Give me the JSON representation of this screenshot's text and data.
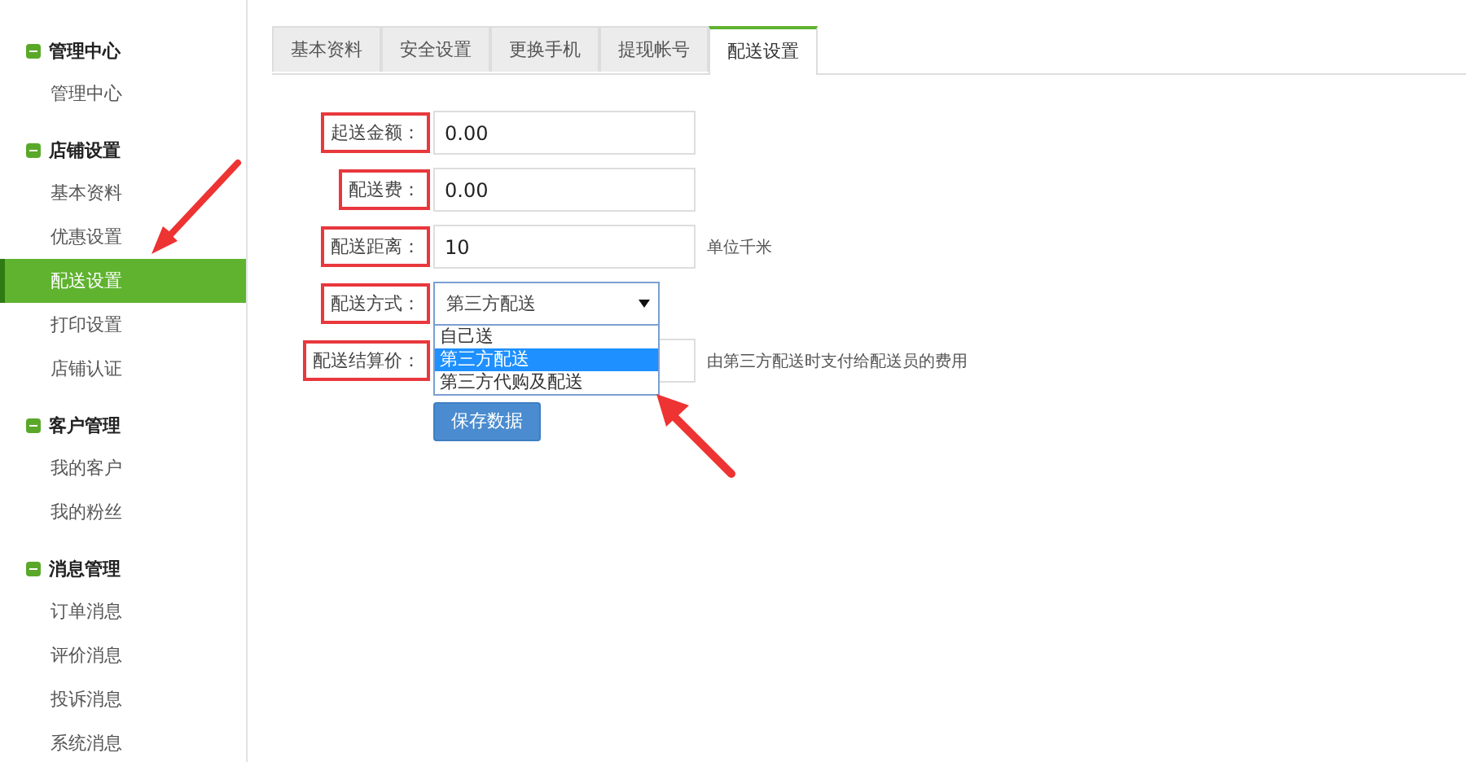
{
  "sidebar": {
    "groups": [
      {
        "title": "管理中心",
        "expanded": true,
        "items": [
          {
            "label": "管理中心",
            "selected": false
          }
        ]
      },
      {
        "title": "店铺设置",
        "expanded": true,
        "items": [
          {
            "label": "基本资料",
            "selected": false
          },
          {
            "label": "优惠设置",
            "selected": false
          },
          {
            "label": "配送设置",
            "selected": true
          },
          {
            "label": "打印设置",
            "selected": false
          },
          {
            "label": "店铺认证",
            "selected": false
          }
        ]
      },
      {
        "title": "客户管理",
        "expanded": true,
        "items": [
          {
            "label": "我的客户",
            "selected": false
          },
          {
            "label": "我的粉丝",
            "selected": false
          }
        ]
      },
      {
        "title": "消息管理",
        "expanded": true,
        "items": [
          {
            "label": "订单消息",
            "selected": false
          },
          {
            "label": "评价消息",
            "selected": false
          },
          {
            "label": "投诉消息",
            "selected": false
          },
          {
            "label": "系统消息",
            "selected": false
          }
        ]
      }
    ]
  },
  "tabs": [
    {
      "label": "基本资料",
      "selected": false
    },
    {
      "label": "安全设置",
      "selected": false
    },
    {
      "label": "更换手机",
      "selected": false
    },
    {
      "label": "提现帐号",
      "selected": false
    },
    {
      "label": "配送设置",
      "selected": true
    }
  ],
  "form": {
    "fields": [
      {
        "kind": "input",
        "label": "起送金额：",
        "highlighted": true,
        "value": "0.00"
      },
      {
        "kind": "input",
        "label": "配送费：",
        "highlighted": true,
        "value": "0.00"
      },
      {
        "kind": "input",
        "label": "配送距离：",
        "highlighted": true,
        "value": "10",
        "note": "单位千米"
      },
      {
        "kind": "select",
        "label": "配送方式：",
        "highlighted": true,
        "value": "第三方配送",
        "expanded": true,
        "options": [
          {
            "label": "自己送",
            "selected": false
          },
          {
            "label": "第三方配送",
            "selected": true
          },
          {
            "label": "第三方代购及配送",
            "selected": false
          }
        ]
      },
      {
        "kind": "input",
        "label": "配送结算价：",
        "highlighted": true,
        "note": "由第三方配送时支付给配送员的费用"
      }
    ],
    "save_button": "保存数据"
  }
}
